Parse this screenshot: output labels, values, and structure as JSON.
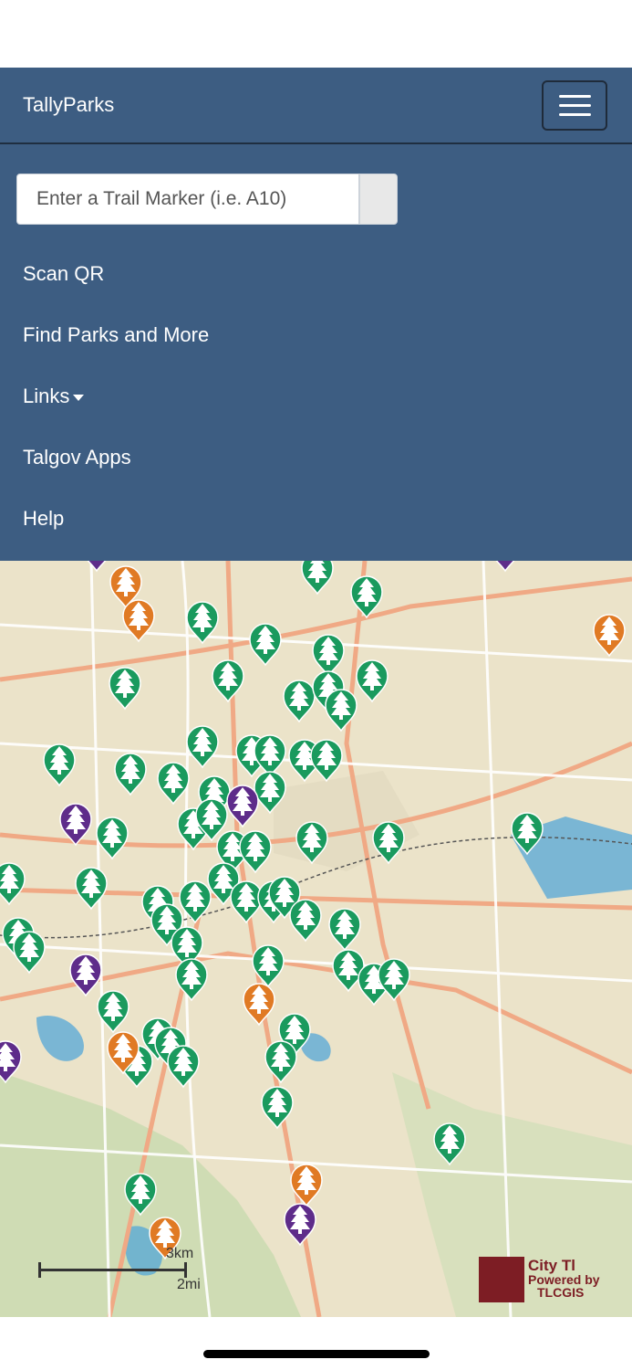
{
  "app": {
    "title": "TallyParks"
  },
  "menu_toggle": {
    "icon": "hamburger-icon"
  },
  "search": {
    "placeholder": "Enter a Trail Marker (i.e. A10)",
    "value": ""
  },
  "menu": {
    "scan_qr": "Scan QR",
    "find_parks": "Find Parks and More",
    "links": "Links",
    "talgov_apps": "Talgov Apps",
    "help": "Help"
  },
  "map": {
    "scale_km": "3km",
    "scale_mi": "2mi",
    "attribution_line1": "City Tl",
    "attribution_line2": "Powered by",
    "attribution_line3": "TLCGIS",
    "marker_colors": {
      "park": "#1a9a5e",
      "amenity": "#e07a24",
      "other": "#5e2c8a"
    }
  }
}
